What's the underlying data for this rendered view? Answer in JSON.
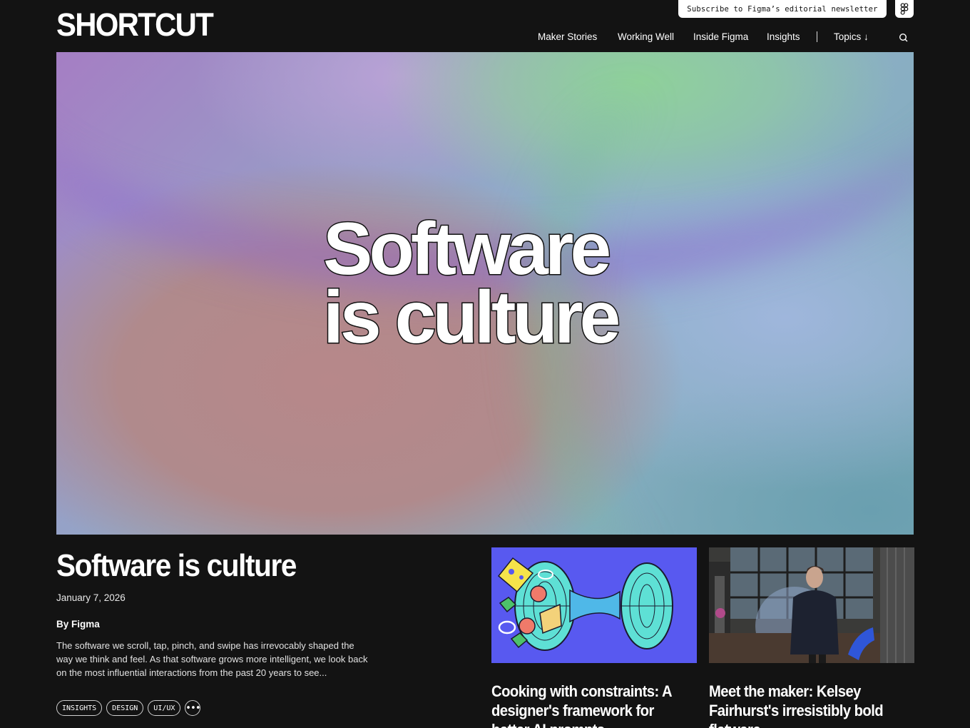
{
  "header": {
    "logo": "SHORTCUT",
    "newsletter_label": "Subscribe to Figma’s editorial newsletter",
    "nav": [
      "Maker Stories",
      "Working Well",
      "Inside Figma",
      "Insights"
    ],
    "topics_label": "Topics ↓"
  },
  "hero": {
    "title_line1": "Software",
    "title_line2": "is culture"
  },
  "featured": {
    "title": "Software is culture",
    "date": "January 7, 2026",
    "byline": "By Figma",
    "excerpt": "The software we scroll, tap, pinch, and swipe has irrevocably shaped the way we think and feel. As that software grows more intelligent, we look back on the most influential interactions from the past 20 years to see...",
    "tags": [
      "INSIGHTS",
      "DESIGN",
      "UI/UX"
    ],
    "more_label": "•••"
  },
  "cards": [
    {
      "title": "Cooking with constraints: A designer's framework for better AI prompts"
    },
    {
      "title": "Meet the maker: Kelsey Fairhurst's irresistibly bold flatware"
    }
  ],
  "colors": {
    "background": "#131313",
    "card1_background": "#5859f0"
  }
}
